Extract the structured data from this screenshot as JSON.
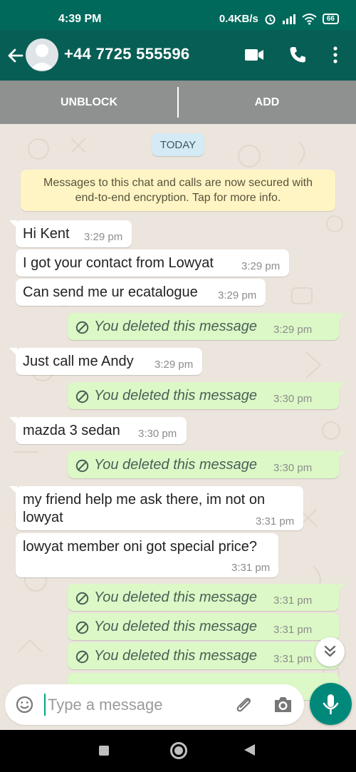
{
  "status_bar": {
    "time": "4:39 PM",
    "network_speed": "0.4KB/s",
    "battery": "66",
    "icons": [
      "alarm-icon",
      "signal-icon",
      "wifi-icon",
      "battery-icon"
    ]
  },
  "header": {
    "contact": "+44 7725 555596",
    "icons": [
      "back-arrow-icon",
      "default-avatar",
      "video-call-icon",
      "voice-call-icon",
      "more-options-icon"
    ]
  },
  "actions": {
    "unblock_label": "UNBLOCK",
    "add_label": "ADD"
  },
  "chat": {
    "date_label": "TODAY",
    "encryption_line1": "Messages to this chat and calls are now secured with",
    "encryption_line2": "end-to-end encryption. Tap for more info.",
    "messages": [
      {
        "direction": "incoming",
        "text": "Hi Kent",
        "time": "3:29 pm"
      },
      {
        "direction": "incoming",
        "text": "I got your contact from Lowyat",
        "time": "3:29 pm"
      },
      {
        "direction": "incoming",
        "text": "Can send me ur ecatalogue",
        "time": "3:29 pm"
      },
      {
        "direction": "outgoing",
        "text": "You deleted this message",
        "time": "3:29 pm",
        "deleted": true
      },
      {
        "direction": "incoming",
        "text": "Just call me Andy",
        "time": "3:29 pm"
      },
      {
        "direction": "outgoing",
        "text": "You deleted this message",
        "time": "3:30 pm",
        "deleted": true
      },
      {
        "direction": "incoming",
        "text": "mazda 3 sedan",
        "time": "3:30 pm"
      },
      {
        "direction": "outgoing",
        "text": "You deleted this message",
        "time": "3:30 pm",
        "deleted": true
      },
      {
        "direction": "incoming",
        "text_lines": [
          "my friend help me ask there, im not on",
          "lowyat"
        ],
        "time": "3:31 pm"
      },
      {
        "direction": "incoming",
        "text": "lowyat member oni got special price?",
        "time": "3:31 pm"
      },
      {
        "direction": "outgoing",
        "text": "You deleted this message",
        "time": "3:31 pm",
        "deleted": true
      },
      {
        "direction": "outgoing",
        "text": "You deleted this message",
        "time": "3:31 pm",
        "deleted": true
      },
      {
        "direction": "outgoing",
        "text": "You deleted this message",
        "time": "3:31 pm",
        "deleted": true
      }
    ]
  },
  "composer": {
    "placeholder": "Type a message",
    "icons": [
      "emoji-icon",
      "attach-icon",
      "camera-icon",
      "microphone-icon"
    ]
  },
  "colors": {
    "app_bar": "#075e54",
    "status_bar": "#00695c",
    "action_bar": "#8e9190",
    "chat_background": "#ece5dd",
    "incoming_bubble": "#ffffff",
    "outgoing_bubble": "#dcf8c6",
    "accent": "#00897b"
  }
}
